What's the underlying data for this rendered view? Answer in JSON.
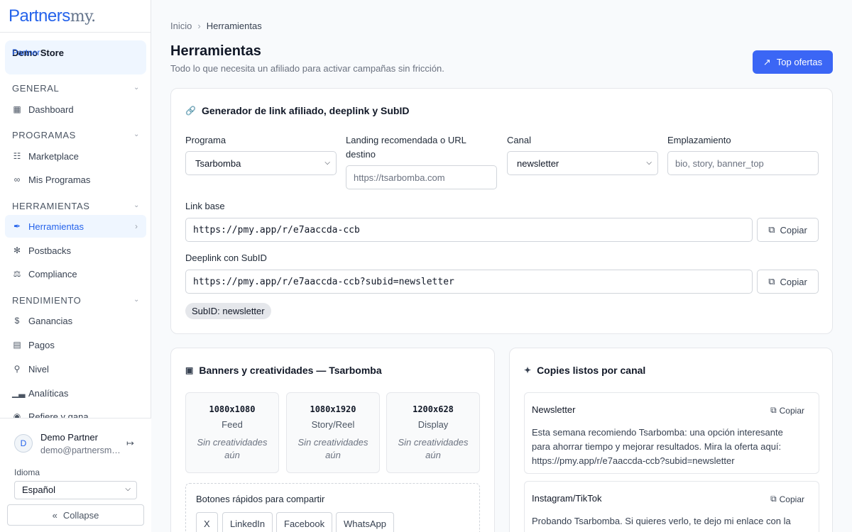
{
  "brand": {
    "name_main": "Partners",
    "name_suffix": "my."
  },
  "partner": {
    "label": "Partner",
    "name": "Demo Store"
  },
  "sidebar": {
    "sections": [
      {
        "title": "GENERAL"
      },
      {
        "title": "PROGRAMAS"
      },
      {
        "title": "HERRAMIENTAS"
      },
      {
        "title": "RENDIMIENTO"
      }
    ],
    "items": [
      {
        "label": "Dashboard"
      },
      {
        "label": "Marketplace"
      },
      {
        "label": "Mis Programas"
      },
      {
        "label": "Herramientas"
      },
      {
        "label": "Postbacks"
      },
      {
        "label": "Compliance"
      },
      {
        "label": "Ganancias"
      },
      {
        "label": "Pagos"
      },
      {
        "label": "Nivel"
      },
      {
        "label": "Analíticas"
      },
      {
        "label": "Refiere y gana"
      }
    ]
  },
  "user": {
    "initial": "D",
    "name": "Demo Partner",
    "email": "demo@partnersmy.com"
  },
  "language": {
    "label": "Idioma",
    "value": "Español"
  },
  "collapse_label": "Collapse",
  "breadcrumb": {
    "home": "Inicio",
    "current": "Herramientas"
  },
  "page": {
    "title": "Herramientas",
    "subtitle": "Todo lo que necesita un afiliado para activar campañas sin fricción.",
    "top_button": "Top ofertas"
  },
  "generator": {
    "title": "Generador de link afiliado, deeplink y SubID",
    "program_label": "Programa",
    "program_value": "Tsarbomba",
    "landing_label": "Landing recomendada o URL destino",
    "landing_placeholder": "https://tsarbomba.com",
    "channel_label": "Canal",
    "channel_value": "newsletter",
    "placement_label": "Emplazamiento",
    "placement_placeholder": "bio, story, banner_top",
    "base_label": "Link base",
    "base_value": "https://pmy.app/r/e7aaccda-ccb",
    "deeplink_label": "Deeplink con SubID",
    "deeplink_value": "https://pmy.app/r/e7aaccda-ccb?subid=newsletter",
    "copy_label": "Copiar",
    "subid_badge": "SubID: newsletter"
  },
  "banners": {
    "title": "Banners y creatividades — Tsarbomba",
    "tiles": [
      {
        "size": "1080x1080",
        "kind": "Feed",
        "empty": "Sin creatividades aún"
      },
      {
        "size": "1080x1920",
        "kind": "Story/Reel",
        "empty": "Sin creatividades aún"
      },
      {
        "size": "1200x628",
        "kind": "Display",
        "empty": "Sin creatividades aún"
      }
    ],
    "share_title": "Botones rápidos para compartir",
    "share_buttons": [
      "X",
      "LinkedIn",
      "Facebook",
      "WhatsApp"
    ]
  },
  "copies": {
    "title": "Copies listos por canal",
    "copy_label": "Copiar",
    "items": [
      {
        "channel": "Newsletter",
        "text": "Esta semana recomiendo Tsarbomba: una opción interesante para ahorrar tiempo y mejorar resultados. Mira la oferta aquí: https://pmy.app/r/e7aaccda-ccb?subid=newsletter"
      },
      {
        "channel": "Instagram/TikTok",
        "text": "Probando Tsarbomba. Si quieres verlo, te dejo mi enlace con la"
      }
    ]
  },
  "colors": {
    "accent": "#3b66f5",
    "brand": "#2563eb",
    "active_bg": "#eff6ff"
  }
}
